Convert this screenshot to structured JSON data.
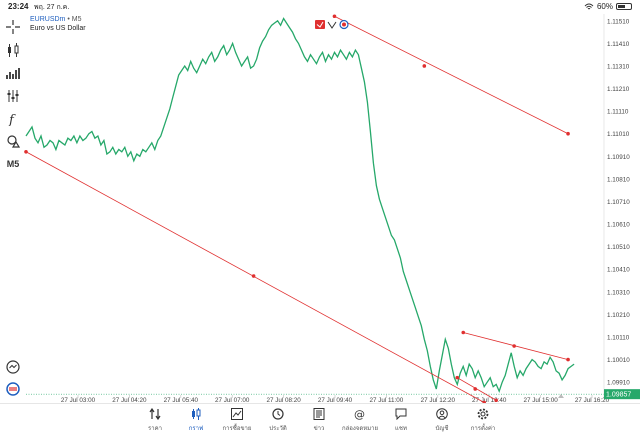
{
  "status_bar": {
    "time": "23:24",
    "date": "พฤ. 27 ก.ค.",
    "battery": "60%",
    "battery_level": 0.6
  },
  "symbol": {
    "name": "EURUSDm",
    "timeframe": "M5",
    "description": "Euro vs US Dollar",
    "separator": "•"
  },
  "toolbar": {
    "items": [
      {
        "name": "crosshair-icon"
      },
      {
        "name": "candles-icon"
      },
      {
        "name": "indicators-icon"
      },
      {
        "name": "objects-icon"
      },
      {
        "name": "function-icon"
      },
      {
        "name": "shapes-icon"
      },
      {
        "name": "timeframe-button",
        "label": "M5"
      }
    ],
    "bottom": [
      "alerts-icon",
      "one-click-trading-icon"
    ]
  },
  "current_price": "1.09857",
  "colors": {
    "line": "#26a86a",
    "trendline": "#e03030",
    "price_badge": "#26a86a",
    "active": "#1f5fbf",
    "grid": "#e8e8e8"
  },
  "chart_data": {
    "type": "line",
    "symbol": "EURUSDm",
    "timeframe": "M5",
    "y_ticks": [
      "1.11510",
      "1.11410",
      "1.11310",
      "1.11210",
      "1.11110",
      "1.11010",
      "1.10910",
      "1.10810",
      "1.10710",
      "1.10610",
      "1.10510",
      "1.10410",
      "1.10310",
      "1.10210",
      "1.10110",
      "1.10010",
      "1.09910"
    ],
    "x_ticks": [
      "27 Jul 03:00",
      "27 Jul 04:20",
      "27 Jul 05:40",
      "27 Jul 07:00",
      "27 Jul 08:20",
      "27 Jul 09:40",
      "27 Jul 11:00",
      "27 Jul 12:20",
      "27 Jul 13:40",
      "27 Jul 15:00",
      "27 Jul 16:20"
    ],
    "ylim": [
      1.0984,
      1.1154
    ],
    "xlim": [
      0,
      193
    ],
    "values": [
      1.11,
      1.1102,
      1.1104,
      1.1099,
      1.1097,
      1.11,
      1.1095,
      1.1096,
      1.1098,
      1.1097,
      1.1094,
      1.1098,
      1.1097,
      1.1096,
      1.1099,
      1.1098,
      1.11,
      1.1097,
      1.11,
      1.1098,
      1.1099,
      1.1101,
      1.1102,
      1.1099,
      1.11,
      1.1096,
      1.1098,
      1.1092,
      1.1093,
      1.1095,
      1.1092,
      1.1094,
      1.1093,
      1.1095,
      1.1091,
      1.1093,
      1.1089,
      1.1092,
      1.1091,
      1.1094,
      1.1093,
      1.1095,
      1.1097,
      1.1094,
      1.1098,
      1.11,
      1.1104,
      1.1108,
      1.1112,
      1.1117,
      1.1122,
      1.1127,
      1.1129,
      1.1131,
      1.1129,
      1.1133,
      1.113,
      1.1128,
      1.1131,
      1.1134,
      1.1132,
      1.1135,
      1.1137,
      1.1133,
      1.1135,
      1.1138,
      1.114,
      1.1136,
      1.1138,
      1.1141,
      1.1137,
      1.1134,
      1.1131,
      1.1133,
      1.1135,
      1.113,
      1.1131,
      1.1134,
      1.1139,
      1.1142,
      1.1144,
      1.1147,
      1.1149,
      1.115,
      1.1151,
      1.1149,
      1.1152,
      1.115,
      1.1148,
      1.1146,
      1.1143,
      1.1141,
      1.1138,
      1.1135,
      1.1133,
      1.1136,
      1.1134,
      1.1132,
      1.1135,
      1.1137,
      1.1133,
      1.1136,
      1.1134,
      1.1137,
      1.1135,
      1.1138,
      1.1136,
      1.1134,
      1.1137,
      1.1135,
      1.1138,
      1.1136,
      1.113,
      1.1124,
      1.1115,
      1.1102,
      1.1088,
      1.1078,
      1.1072,
      1.1068,
      1.1064,
      1.106,
      1.1056,
      1.1054,
      1.105,
      1.1046,
      1.104,
      1.1036,
      1.1032,
      1.1028,
      1.1024,
      1.102,
      1.1016,
      1.101,
      1.1005,
      1.0998,
      1.0992,
      1.0988,
      1.0996,
      1.1003,
      1.101,
      1.1006,
      1.0999,
      1.0993,
      1.099,
      1.0995,
      1.0998,
      1.0994,
      1.0999,
      1.0997,
      1.0993,
      1.0996,
      1.0993,
      1.0989,
      1.0991,
      1.0993,
      1.0989,
      1.099,
      1.0987,
      1.0991,
      1.0994,
      1.0999,
      1.1004,
      1.0998,
      1.0993,
      1.0996,
      1.0994,
      1.0997,
      1.0999,
      1.1001,
      1.1,
      1.0998,
      1.0997,
      1.1,
      1.0999,
      1.1002,
      1.1,
      1.0996,
      1.0995,
      1.0992,
      1.0994,
      1.0997,
      1.0998,
      1.0999
    ],
    "trendlines": [
      {
        "x1": 103,
        "y1": 1.1153,
        "x2": 181,
        "y2": 1.1101,
        "mid": [
          133,
          1.1131
        ]
      },
      {
        "x1": 0,
        "y1": 1.1093,
        "x2": 153,
        "y2": 1.0982,
        "mid": [
          76,
          1.1038
        ]
      },
      {
        "x1": 146,
        "y1": 1.1013,
        "x2": 181,
        "y2": 1.1001,
        "mid": [
          163,
          1.1007
        ]
      },
      {
        "x1": 144,
        "y1": 1.0993,
        "x2": 157,
        "y2": 1.0983,
        "mid": [
          150,
          1.0988
        ]
      }
    ],
    "current_price": 1.09857,
    "grid": true
  },
  "bottom_nav": [
    {
      "name": "nav-quotes",
      "icon": "quotes-icon",
      "label": "ราคา"
    },
    {
      "name": "nav-chart",
      "icon": "chart-icon",
      "label": "กราฟ",
      "active": true
    },
    {
      "name": "nav-trade",
      "icon": "trade-icon",
      "label": "การซื้อขาย"
    },
    {
      "name": "nav-history",
      "icon": "history-icon",
      "label": "ประวัติ"
    },
    {
      "name": "nav-news",
      "icon": "news-icon",
      "label": "ข่าว"
    },
    {
      "name": "nav-mailbox",
      "icon": "mailbox-icon",
      "label": "กล่องจดหมาย"
    },
    {
      "name": "nav-chat",
      "icon": "chat-icon",
      "label": "แชท"
    },
    {
      "name": "nav-accounts",
      "icon": "accounts-icon",
      "label": "บัญชี"
    },
    {
      "name": "nav-settings",
      "icon": "settings-icon",
      "label": "การตั้งค่า"
    }
  ]
}
